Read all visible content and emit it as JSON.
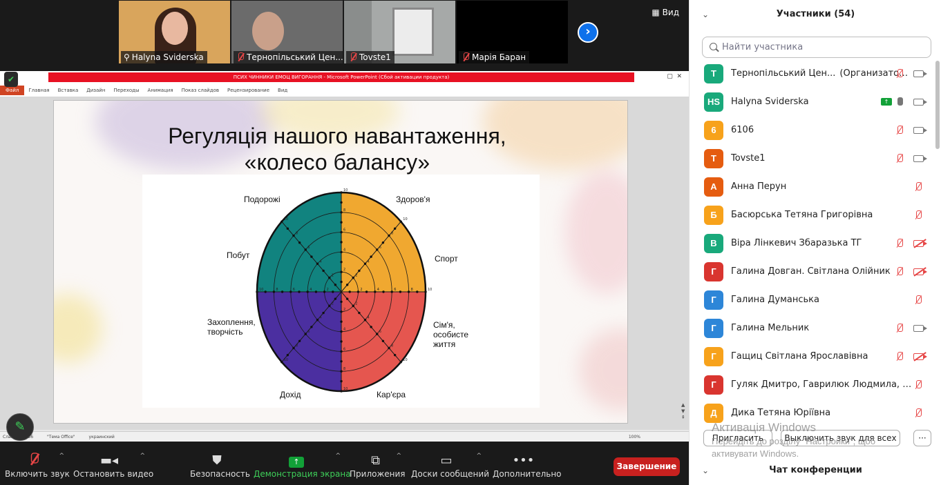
{
  "thumbnails": [
    {
      "name": "Halyna Sviderska",
      "bg": "#d9a55c"
    },
    {
      "name": "Тернопільський Цен...",
      "bg": "#6b6b6b"
    },
    {
      "name": "Tovste1",
      "bg": "#a6a9a8"
    },
    {
      "name": "Марія Баран",
      "bg": "#000000"
    }
  ],
  "view_label": "Вид",
  "ppt": {
    "window_title": "ПСИХ ЧИННИКИ ЕМОЦ ВИГОРАННЯ  -  Microsoft PowerPoint (Сбой активации продукта)",
    "menu": [
      "Файл",
      "Главная",
      "Вставка",
      "Дизайн",
      "Переходы",
      "Анимация",
      "Показ слайдов",
      "Рецензирование",
      "Вид"
    ],
    "status": [
      "Слайд 3 из 36",
      "\"Тема Office\"",
      "украинский"
    ],
    "zoom": "100%"
  },
  "slide": {
    "title_line1": "Регуляція нашого навантаження,",
    "title_line2": "«колесо балансу»",
    "labels": {
      "travel": "Подорожі",
      "health": "Здоров'я",
      "sport": "Спорт",
      "home": "Побут",
      "family": "Сім'я,\nособисте\nжиття",
      "hobby": "Захоплення,\nтворчість",
      "income": "Дохід",
      "career": "Кар'єра"
    },
    "colors": {
      "top_left": "#11837f",
      "top_right": "#f0a830",
      "bottom_left": "#4b2fa0",
      "bottom_right": "#e5564f"
    }
  },
  "toolbar": {
    "mute": "Включить звук",
    "video": "Остановить видео",
    "security": "Безопасность",
    "share": "Демонстрация экрана",
    "apps": "Приложения",
    "whiteboards": "Доски сообщений",
    "more": "Дополнительно",
    "end": "Завершение"
  },
  "sidebar": {
    "title": "Участники (54)",
    "search_placeholder": "Найти участника",
    "participants": [
      {
        "initial": "Т",
        "color": "#19a97b",
        "name": "Тернопільський Цен...",
        "suffix": "(Организатор, я)",
        "mic": "off",
        "video": "on"
      },
      {
        "initial": "HS",
        "color": "#19a97b",
        "name": "Halyna Sviderska",
        "suffix": "",
        "mic": "on",
        "video": "on",
        "sharing": true
      },
      {
        "initial": "6",
        "color": "#f7a21b",
        "name": "6106",
        "suffix": "",
        "mic": "off",
        "video": "on"
      },
      {
        "initial": "T",
        "color": "#e55c10",
        "name": "Tovste1",
        "suffix": "",
        "mic": "off",
        "video": "on"
      },
      {
        "initial": "А",
        "color": "#e55c10",
        "name": "Анна Перун",
        "suffix": "",
        "mic": "off",
        "video": "none"
      },
      {
        "initial": "Б",
        "color": "#f7a21b",
        "name": "Басюрська Тетяна Григорівна",
        "suffix": "",
        "mic": "off",
        "video": "none"
      },
      {
        "initial": "В",
        "color": "#19a97b",
        "name": "Віра Лінкевич Збаразька ТГ",
        "suffix": "",
        "mic": "off",
        "video": "off"
      },
      {
        "initial": "Г",
        "color": "#d9352f",
        "name": "Галина Довган. Світлана Олійник",
        "suffix": "",
        "mic": "off",
        "video": "off"
      },
      {
        "initial": "Г",
        "color": "#2d86d8",
        "name": "Галина Думанська",
        "suffix": "",
        "mic": "off",
        "video": "none"
      },
      {
        "initial": "Г",
        "color": "#2d86d8",
        "name": "Галина Мельник",
        "suffix": "",
        "mic": "off",
        "video": "on"
      },
      {
        "initial": "Г",
        "color": "#f7a21b",
        "name": "Гащиц Світлана Ярославівна",
        "suffix": "",
        "mic": "off",
        "video": "off"
      },
      {
        "initial": "Г",
        "color": "#d9352f",
        "name": "Гуляк Дмитро, Гаврилюк Людмила, Вальч...",
        "suffix": "",
        "mic": "off",
        "video": "none"
      },
      {
        "initial": "Д",
        "color": "#f7a21b",
        "name": "Дика Тетяна Юріївна",
        "suffix": "",
        "mic": "off",
        "video": "none"
      }
    ],
    "invite": "Пригласить",
    "mute_all": "Выключить звук для всех",
    "more": "···",
    "chat_title": "Чат конференции"
  },
  "watermark": {
    "line1": "Активація Windows",
    "line2": "Перейдіть до розділу \"Настройки\", щоб",
    "line3": "активувати Windows."
  }
}
